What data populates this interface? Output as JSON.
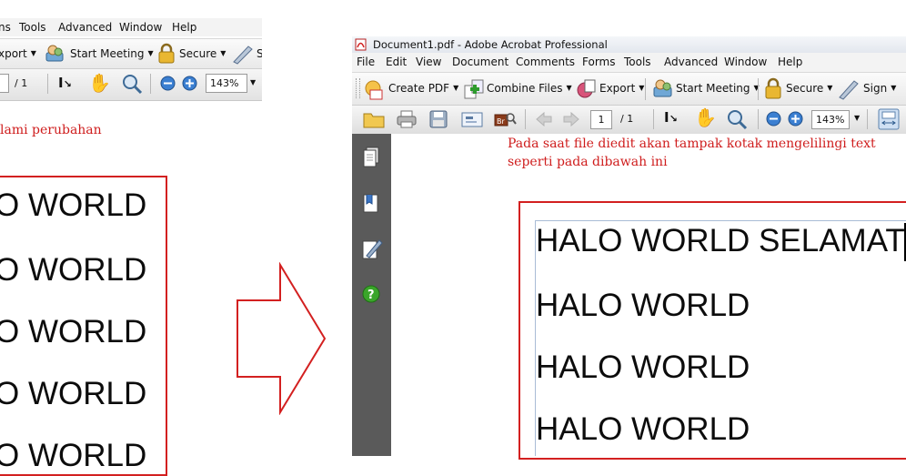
{
  "left_window": {
    "menu": [
      "ns",
      "Tools",
      "Advanced",
      "Window",
      "Help"
    ],
    "toolbar": {
      "export_label": "xport",
      "start_meeting_label": "Start Meeting",
      "secure_label": "Secure",
      "sign_label": "S"
    },
    "nav": {
      "page_value": "",
      "page_total": "/ 1",
      "zoom_value": "143%"
    }
  },
  "left_note": "lami perubahan",
  "left_lines": [
    "O WORLD",
    "O WORLD",
    "O WORLD",
    "O WORLD",
    "O WORLD"
  ],
  "right_window": {
    "title": "Document1.pdf - Adobe Acrobat Professional",
    "menu": [
      "File",
      "Edit",
      "View",
      "Document",
      "Comments",
      "Forms",
      "Tools",
      "Advanced",
      "Window",
      "Help"
    ],
    "toolbar": {
      "create_pdf_label": "Create PDF",
      "combine_files_label": "Combine Files",
      "export_label": "Export",
      "start_meeting_label": "Start Meeting",
      "secure_label": "Secure",
      "sign_label": "Sign"
    },
    "nav": {
      "page_value": "1",
      "page_total": "/ 1",
      "zoom_value": "143%"
    },
    "note_line1": "Pada saat file diedit akan tampak kotak mengelilingi text",
    "note_line2": "seperti pada dibawah ini",
    "lines": [
      "HALO WORLD SELAMAT",
      "HALO WORLD",
      "HALO WORLD",
      "HALO WORLD"
    ]
  },
  "colors": {
    "annotation_red": "#d32020",
    "sidebar_gray": "#5a5a5a",
    "help_green": "#3aa52a"
  },
  "icons": [
    "create-pdf-icon",
    "combine-files-icon",
    "export-icon",
    "start-meeting-icon",
    "lock-icon",
    "sign-pen-icon",
    "folder-icon",
    "print-icon",
    "save-icon",
    "email-icon",
    "bridge-icon",
    "arrow-up-icon",
    "arrow-down-icon",
    "select-text-icon",
    "hand-icon",
    "zoom-icon",
    "zoom-out-icon",
    "zoom-in-icon",
    "fit-page-icon",
    "pages-icon",
    "bookmarks-icon",
    "signatures-icon",
    "help-icon",
    "arrow-right-icon"
  ]
}
